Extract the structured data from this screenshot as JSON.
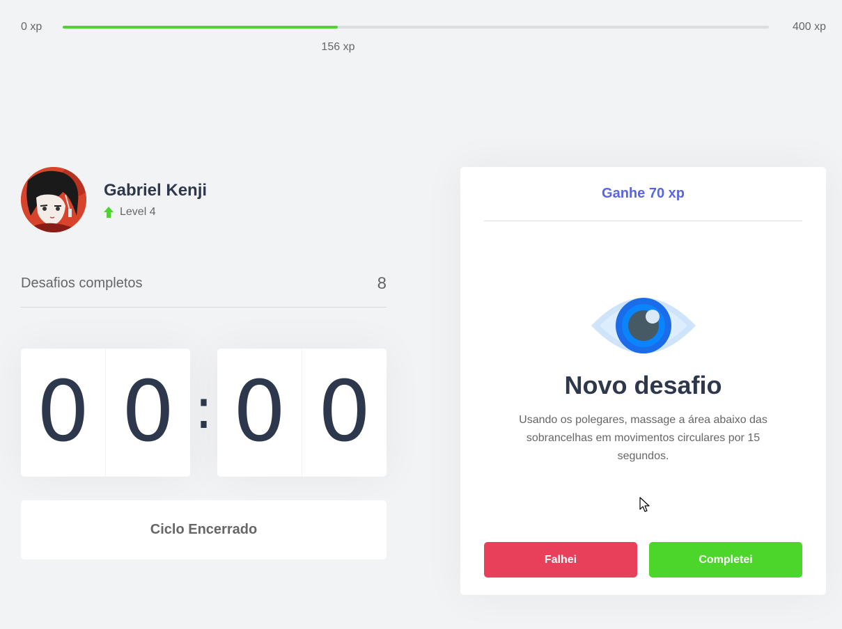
{
  "xp": {
    "min_label": "0 xp",
    "max_label": "400 xp",
    "current_label": "156 xp",
    "current_value": 156,
    "max_value": 400,
    "fill_color": "#4cd62b"
  },
  "profile": {
    "name": "Gabriel Kenji",
    "level_label": "Level 4",
    "level_icon": "level-up-arrow-icon"
  },
  "challenges": {
    "completed_label": "Desafios completos",
    "completed_count": "8"
  },
  "countdown": {
    "minute_left": "0",
    "minute_right": "0",
    "separator": ":",
    "second_left": "0",
    "second_right": "0"
  },
  "cycle_button": {
    "label": "Ciclo Encerrado"
  },
  "challenge_card": {
    "header": "Ganhe 70 xp",
    "icon": "eye-icon",
    "title": "Novo desafio",
    "description": "Usando os polegares, massage a área abaixo das sobrancelhas em movimentos circulares por 15 segundos.",
    "failed_label": "Falhei",
    "completed_label": "Completei"
  },
  "colors": {
    "accent_blue": "#5965e0",
    "red": "#e83f5b",
    "green": "#4cd62b",
    "title": "#2e384d",
    "text": "#666666",
    "background": "#f2f3f5"
  }
}
